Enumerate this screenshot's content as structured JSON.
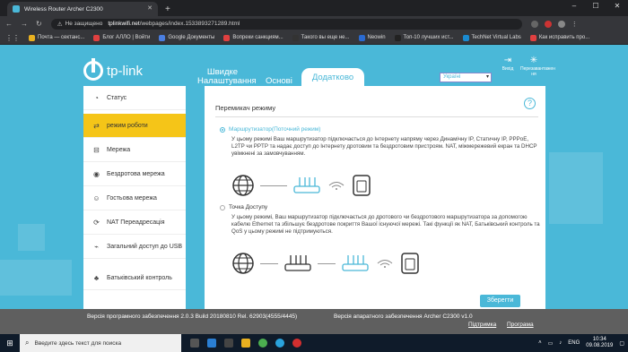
{
  "browser": {
    "tab_title": "Wireless Router Archer C2300",
    "not_secure": "Не защищено",
    "url_host": "tplinkwifi.net",
    "url_path": "/webpages/index.1533893271289.html",
    "bookmarks": [
      {
        "label": "Почта — сектанс...",
        "color": "#e8b020"
      },
      {
        "label": "Блог АЛЛО | Войти",
        "color": "#e04040"
      },
      {
        "label": "Google Документы",
        "color": "#4a7ee0"
      },
      {
        "label": "Вопреки санкциям...",
        "color": "#e04040"
      },
      {
        "label": "Такого вы еще не...",
        "color": "#333333"
      },
      {
        "label": "Neowin",
        "color": "#2a6ad0"
      },
      {
        "label": "Топ-10 лучших ист...",
        "color": "#222222"
      },
      {
        "label": "TechNet Virtual Labs",
        "color": "#1a8ad0"
      },
      {
        "label": "Как исправить про...",
        "color": "#e04040"
      }
    ]
  },
  "router": {
    "logo": "tp-link",
    "tabs": [
      "Швидке Налаштування",
      "Основі",
      "Додатково"
    ],
    "language": "Україні",
    "exit_label": "Вихід",
    "reboot_label": "Перезавантажен ня",
    "sidebar": [
      {
        "label": "Статус",
        "icon": "status-icon"
      },
      {
        "label": "режим роботи",
        "icon": "operation-mode-icon"
      },
      {
        "label": "Мережа",
        "icon": "network-icon"
      },
      {
        "label": "Бездротова мережа",
        "icon": "wireless-icon"
      },
      {
        "label": "Гостьова мережа",
        "icon": "guest-network-icon"
      },
      {
        "label": "NAT Переадресація",
        "icon": "nat-forwarding-icon"
      },
      {
        "label": "Загальний доступ до USB",
        "icon": "usb-sharing-icon"
      },
      {
        "label": "Батьківський контроль",
        "icon": "parental-control-icon"
      }
    ],
    "content_title": "Перемикач режиму",
    "mode_router_label": "Маршрутизатор(Поточний режим)",
    "mode_router_desc": "У цьому режимі Ваш маршрутизатор підключається до Інтернету напряму через Динамічну IP, Статичну IP, PPPoE, L2TP чи PPTP та надає доступ до Інтернету дротовим та бездротовим пристроям. NAT, міжмережевий екран та DHCP увімкнені за замовчуванням.",
    "mode_ap_label": "Точка Доступу",
    "mode_ap_desc": "У цьому режимі, Ваш маршрутизатор підключається до дротового чи бездротового маршрутизатора за допомогою кабелю Ethernet та збільшує бездротове покриття Вашої існуючої мережі. Такі функції як NAT, Батьківський контроль та QoS у цьому режимі не підтримуються.",
    "save_label": "Зберегти",
    "firmware": "Версія програмного забезпечення 2.0.3 Build 20180810 Rel. 62903(4555/4445)",
    "hardware": "Версія апаратного забезпечення Archer C2300 v1.0",
    "support_link": "Підтримка",
    "app_link": "Програма"
  },
  "taskbar": {
    "search_placeholder": "Введите здесь текст для поиска",
    "lang": "ENG",
    "time": "10:34",
    "date": "09.08.2019"
  },
  "colors": {
    "accent": "#4ab8d8",
    "active_item": "#f5c518"
  }
}
